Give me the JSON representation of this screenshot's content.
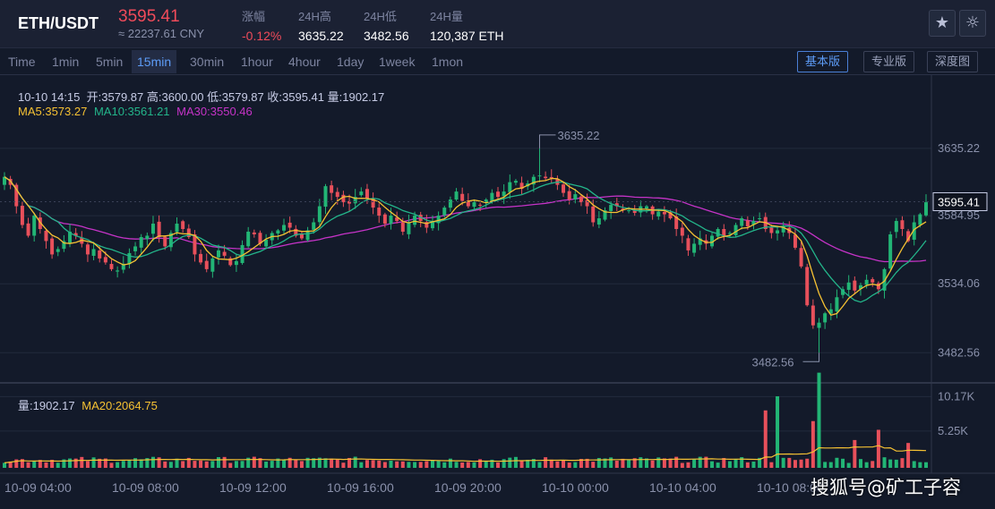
{
  "header": {
    "pair": "ETH/USDT",
    "last_price": "3595.41",
    "cny_price": "≈ 22237.61 CNY",
    "change_label": "涨幅",
    "change_value": "-0.12%",
    "high_label": "24H高",
    "high_value": "3635.22",
    "low_label": "24H低",
    "low_value": "3482.56",
    "volume_label": "24H量",
    "volume_value": "120,387 ETH",
    "favorite_icon": "star-icon",
    "theme_icon": "sun-icon"
  },
  "toolbar": {
    "timeframes": [
      "Time",
      "1min",
      "5min",
      "15min",
      "30min",
      "1hour",
      "4hour",
      "1day",
      "1week",
      "1mon"
    ],
    "active_timeframe": "15min",
    "views": [
      "基本版",
      "专业版",
      "深度图"
    ],
    "active_view": "基本版"
  },
  "info": {
    "datetime": "10-10 14:15",
    "open_label": "开:",
    "open": "3579.87",
    "high_label": "高:",
    "high": "3600.00",
    "low_label": "低:",
    "low": "3579.87",
    "close_label": "收:",
    "close": "3595.41",
    "vol_label": "量:",
    "vol": "1902.17",
    "ma5_label": "MA5:",
    "ma5": "3573.27",
    "ma10_label": "MA10:",
    "ma10": "3561.21",
    "ma30_label": "MA30:",
    "ma30": "3550.46"
  },
  "volume_info": {
    "vol_label": "量:",
    "vol": "1902.17",
    "ma20_label": "MA20:",
    "ma20": "2064.75"
  },
  "watermark": "搜狐号@矿工子容",
  "chart_data": {
    "type": "candlestick",
    "price_axis": {
      "ticks": [
        3635.22,
        3584.95,
        3534.06,
        3482.56
      ],
      "current": 3595.41,
      "range": [
        3460,
        3690
      ]
    },
    "volume_axis": {
      "ticks": [
        "10.17K",
        "5.25K"
      ],
      "tick_values": [
        10170,
        5250
      ],
      "max": 11500
    },
    "time_ticks": [
      "10-09 04:00",
      "10-09 08:00",
      "10-09 12:00",
      "10-09 16:00",
      "10-09 20:00",
      "10-10 00:00",
      "10-10 04:00",
      "10-10 08:00"
    ],
    "high_marker": 3635.22,
    "low_marker": 3482.56,
    "series": {
      "closes": [
        3614,
        3608,
        3592,
        3578,
        3570,
        3585,
        3575,
        3566,
        3556,
        3560,
        3566,
        3573,
        3570,
        3564,
        3556,
        3560,
        3553,
        3550,
        3545,
        3544,
        3549,
        3557,
        3562,
        3569,
        3570,
        3579,
        3569,
        3562,
        3572,
        3579,
        3575,
        3569,
        3556,
        3550,
        3545,
        3553,
        3559,
        3555,
        3548,
        3551,
        3563,
        3573,
        3571,
        3564,
        3567,
        3572,
        3574,
        3578,
        3576,
        3570,
        3568,
        3574,
        3580,
        3592,
        3607,
        3602,
        3599,
        3595,
        3594,
        3599,
        3603,
        3598,
        3591,
        3585,
        3579,
        3585,
        3581,
        3573,
        3580,
        3585,
        3581,
        3576,
        3580,
        3585,
        3591,
        3597,
        3603,
        3596,
        3592,
        3595,
        3593,
        3597,
        3602,
        3599,
        3603,
        3610,
        3611,
        3605,
        3609,
        3614,
        3615,
        3613,
        3613,
        3608,
        3602,
        3597,
        3601,
        3595,
        3592,
        3580,
        3583,
        3589,
        3593,
        3592,
        3589,
        3589,
        3587,
        3592,
        3592,
        3586,
        3588,
        3586,
        3583,
        3575,
        3570,
        3559,
        3564,
        3568,
        3564,
        3570,
        3575,
        3570,
        3572,
        3578,
        3583,
        3577,
        3581,
        3583,
        3575,
        3572,
        3574,
        3577,
        3572,
        3561,
        3547,
        3518,
        3503,
        3505,
        3512,
        3515,
        3524,
        3530,
        3535,
        3529,
        3533,
        3537,
        3535,
        3530,
        3545,
        3571,
        3581,
        3575,
        3566,
        3580,
        3586,
        3595
      ],
      "volume_multipliers": [
        [
          128,
          10.0
        ],
        [
          130,
          7.0
        ],
        [
          136,
          8.5
        ],
        [
          137,
          10.0
        ],
        [
          143,
          4.5
        ],
        [
          147,
          5.0
        ],
        [
          152,
          3.5
        ]
      ],
      "ma_colors": {
        "ma5": "#f5c133",
        "ma10": "#23b58a",
        "ma30": "#c533c7",
        "ma20": "#f5c133"
      }
    }
  }
}
